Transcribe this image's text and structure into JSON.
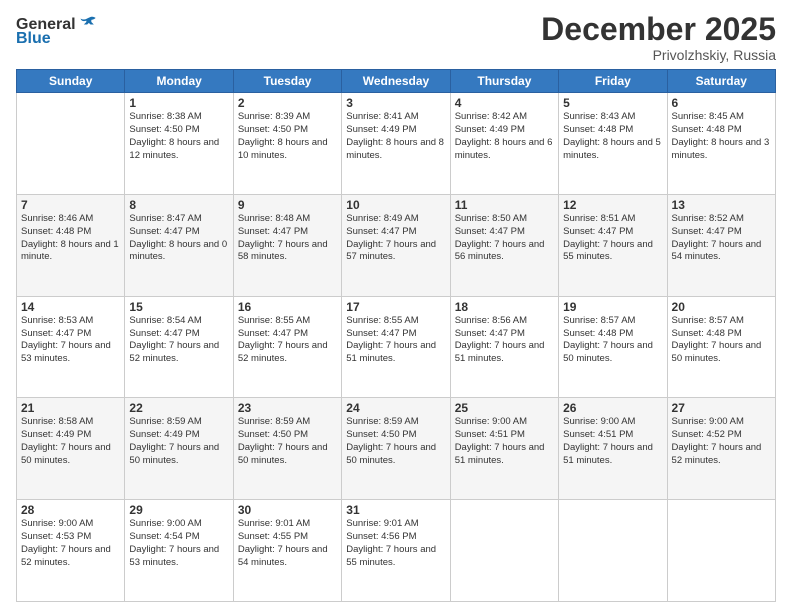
{
  "header": {
    "logo": {
      "line1": "General",
      "line2": "Blue"
    },
    "title": "December 2025",
    "subtitle": "Privolzhskiy, Russia"
  },
  "weekdays": [
    "Sunday",
    "Monday",
    "Tuesday",
    "Wednesday",
    "Thursday",
    "Friday",
    "Saturday"
  ],
  "weeks": [
    [
      null,
      {
        "day": "1",
        "sunrise": "8:38 AM",
        "sunset": "4:50 PM",
        "daylight": "8 hours and 12 minutes."
      },
      {
        "day": "2",
        "sunrise": "8:39 AM",
        "sunset": "4:50 PM",
        "daylight": "8 hours and 10 minutes."
      },
      {
        "day": "3",
        "sunrise": "8:41 AM",
        "sunset": "4:49 PM",
        "daylight": "8 hours and 8 minutes."
      },
      {
        "day": "4",
        "sunrise": "8:42 AM",
        "sunset": "4:49 PM",
        "daylight": "8 hours and 6 minutes."
      },
      {
        "day": "5",
        "sunrise": "8:43 AM",
        "sunset": "4:48 PM",
        "daylight": "8 hours and 5 minutes."
      },
      {
        "day": "6",
        "sunrise": "8:45 AM",
        "sunset": "4:48 PM",
        "daylight": "8 hours and 3 minutes."
      }
    ],
    [
      {
        "day": "7",
        "sunrise": "8:46 AM",
        "sunset": "4:48 PM",
        "daylight": "8 hours and 1 minute."
      },
      {
        "day": "8",
        "sunrise": "8:47 AM",
        "sunset": "4:47 PM",
        "daylight": "8 hours and 0 minutes."
      },
      {
        "day": "9",
        "sunrise": "8:48 AM",
        "sunset": "4:47 PM",
        "daylight": "7 hours and 58 minutes."
      },
      {
        "day": "10",
        "sunrise": "8:49 AM",
        "sunset": "4:47 PM",
        "daylight": "7 hours and 57 minutes."
      },
      {
        "day": "11",
        "sunrise": "8:50 AM",
        "sunset": "4:47 PM",
        "daylight": "7 hours and 56 minutes."
      },
      {
        "day": "12",
        "sunrise": "8:51 AM",
        "sunset": "4:47 PM",
        "daylight": "7 hours and 55 minutes."
      },
      {
        "day": "13",
        "sunrise": "8:52 AM",
        "sunset": "4:47 PM",
        "daylight": "7 hours and 54 minutes."
      }
    ],
    [
      {
        "day": "14",
        "sunrise": "8:53 AM",
        "sunset": "4:47 PM",
        "daylight": "7 hours and 53 minutes."
      },
      {
        "day": "15",
        "sunrise": "8:54 AM",
        "sunset": "4:47 PM",
        "daylight": "7 hours and 52 minutes."
      },
      {
        "day": "16",
        "sunrise": "8:55 AM",
        "sunset": "4:47 PM",
        "daylight": "7 hours and 52 minutes."
      },
      {
        "day": "17",
        "sunrise": "8:55 AM",
        "sunset": "4:47 PM",
        "daylight": "7 hours and 51 minutes."
      },
      {
        "day": "18",
        "sunrise": "8:56 AM",
        "sunset": "4:47 PM",
        "daylight": "7 hours and 51 minutes."
      },
      {
        "day": "19",
        "sunrise": "8:57 AM",
        "sunset": "4:48 PM",
        "daylight": "7 hours and 50 minutes."
      },
      {
        "day": "20",
        "sunrise": "8:57 AM",
        "sunset": "4:48 PM",
        "daylight": "7 hours and 50 minutes."
      }
    ],
    [
      {
        "day": "21",
        "sunrise": "8:58 AM",
        "sunset": "4:49 PM",
        "daylight": "7 hours and 50 minutes."
      },
      {
        "day": "22",
        "sunrise": "8:59 AM",
        "sunset": "4:49 PM",
        "daylight": "7 hours and 50 minutes."
      },
      {
        "day": "23",
        "sunrise": "8:59 AM",
        "sunset": "4:50 PM",
        "daylight": "7 hours and 50 minutes."
      },
      {
        "day": "24",
        "sunrise": "8:59 AM",
        "sunset": "4:50 PM",
        "daylight": "7 hours and 50 minutes."
      },
      {
        "day": "25",
        "sunrise": "9:00 AM",
        "sunset": "4:51 PM",
        "daylight": "7 hours and 51 minutes."
      },
      {
        "day": "26",
        "sunrise": "9:00 AM",
        "sunset": "4:51 PM",
        "daylight": "7 hours and 51 minutes."
      },
      {
        "day": "27",
        "sunrise": "9:00 AM",
        "sunset": "4:52 PM",
        "daylight": "7 hours and 52 minutes."
      }
    ],
    [
      {
        "day": "28",
        "sunrise": "9:00 AM",
        "sunset": "4:53 PM",
        "daylight": "7 hours and 52 minutes."
      },
      {
        "day": "29",
        "sunrise": "9:00 AM",
        "sunset": "4:54 PM",
        "daylight": "7 hours and 53 minutes."
      },
      {
        "day": "30",
        "sunrise": "9:01 AM",
        "sunset": "4:55 PM",
        "daylight": "7 hours and 54 minutes."
      },
      {
        "day": "31",
        "sunrise": "9:01 AM",
        "sunset": "4:56 PM",
        "daylight": "7 hours and 55 minutes."
      },
      null,
      null,
      null
    ]
  ],
  "labels": {
    "sunrise": "Sunrise:",
    "sunset": "Sunset:",
    "daylight": "Daylight:"
  }
}
